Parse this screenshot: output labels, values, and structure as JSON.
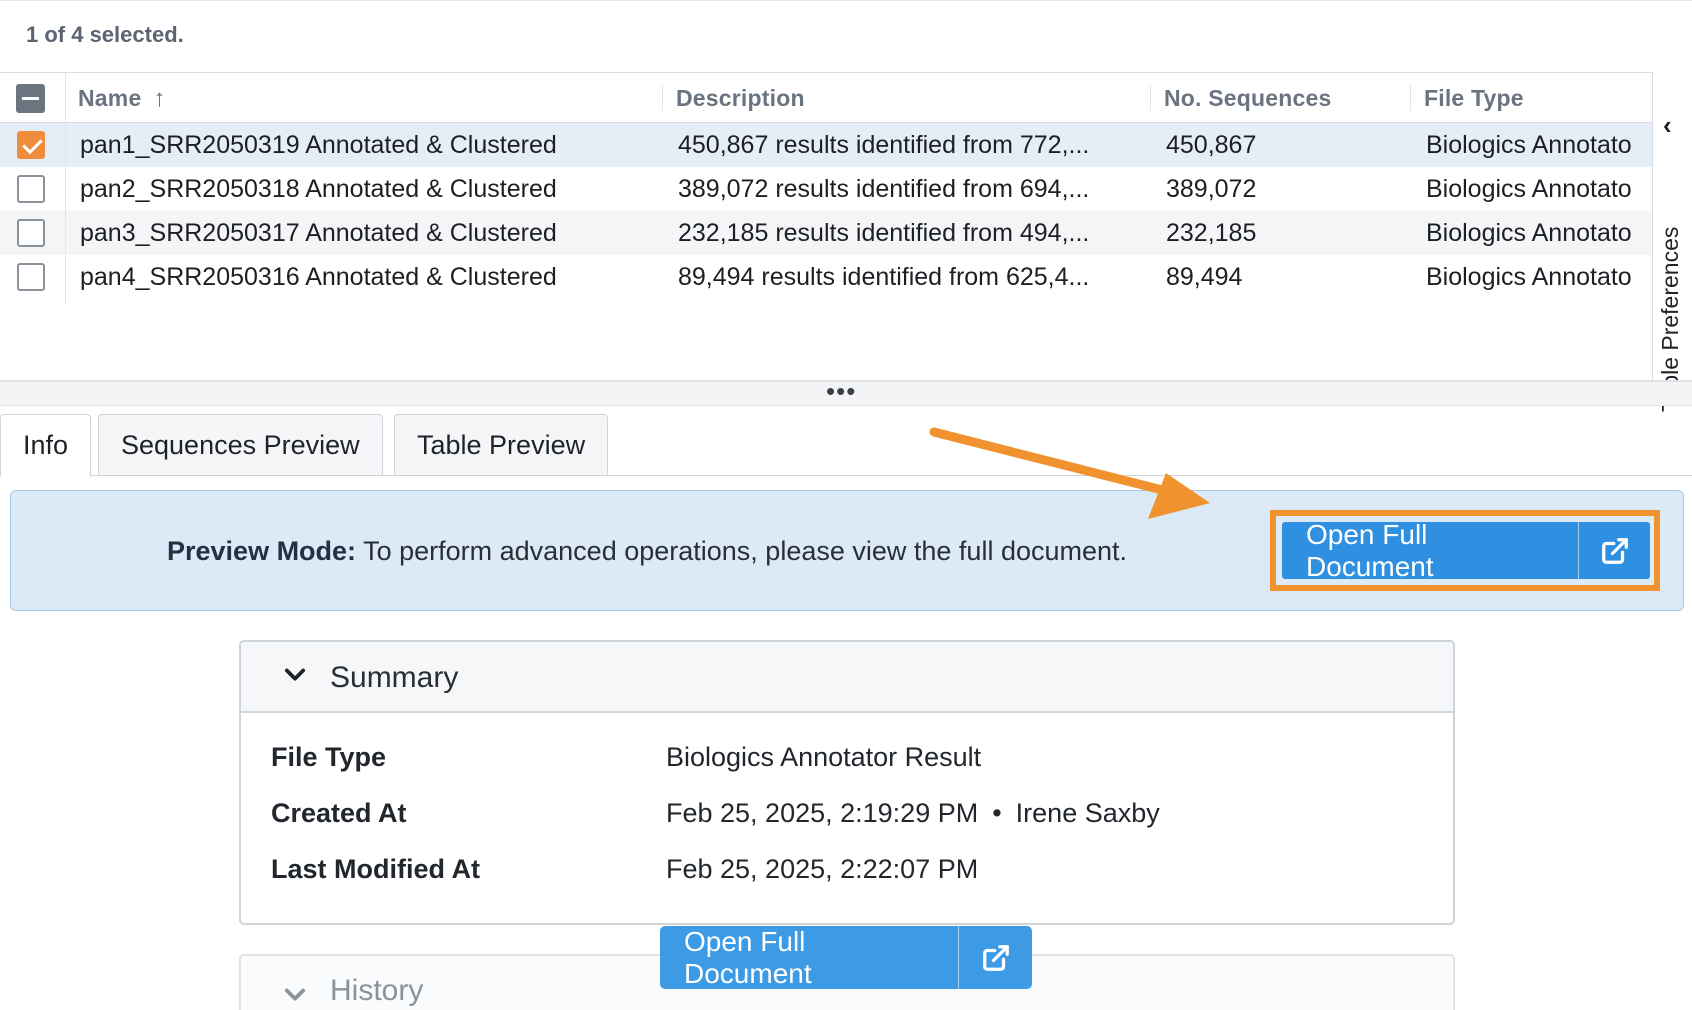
{
  "selection": {
    "status": "1 of 4 selected."
  },
  "table": {
    "columns": {
      "name": "Name",
      "description": "Description",
      "sequences": "No. Sequences",
      "file_type": "File Type"
    },
    "rows": [
      {
        "checked": true,
        "name": "pan1_SRR2050319 Annotated & Clustered",
        "description": "450,867 results identified from 772,...",
        "sequences": "450,867",
        "file_type": "Biologics Annotato"
      },
      {
        "checked": false,
        "name": "pan2_SRR2050318 Annotated & Clustered",
        "description": "389,072 results identified from 694,...",
        "sequences": "389,072",
        "file_type": "Biologics Annotato"
      },
      {
        "checked": false,
        "name": "pan3_SRR2050317 Annotated & Clustered",
        "description": "232,185 results identified from 494,...",
        "sequences": "232,185",
        "file_type": "Biologics Annotato"
      },
      {
        "checked": false,
        "name": "pan4_SRR2050316 Annotated & Clustered",
        "description": "89,494 results identified from 625,4...",
        "sequences": "89,494",
        "file_type": "Biologics Annotato"
      }
    ],
    "preferences_label": "Table Preferences"
  },
  "splitter": {
    "handle": "•••"
  },
  "tabs": [
    {
      "label": "Info",
      "active": true
    },
    {
      "label": "Sequences Preview",
      "active": false
    },
    {
      "label": "Table Preview",
      "active": false
    }
  ],
  "banner": {
    "bold": "Preview Mode:",
    "text": " To perform advanced operations, please view the full document.",
    "button_label": "Open Full Document"
  },
  "summary": {
    "title": "Summary",
    "file_type_key": "File Type",
    "file_type_val": "Biologics Annotator Result",
    "created_key": "Created At",
    "created_val": "Feb 25, 2025, 2:19:29 PM",
    "created_sep": "•",
    "created_by": "Irene Saxby",
    "modified_key": "Last Modified At",
    "modified_val": "Feb 25, 2025, 2:22:07 PM"
  },
  "history": {
    "title": "History"
  },
  "floating_button": {
    "label": "Open Full Document"
  },
  "colors": {
    "accent": "#2f8fe0",
    "highlight": "#f0922d",
    "checkbox": "#ef8d3c",
    "banner_bg": "#dbeaf6"
  },
  "icons": [
    "sort-up-icon",
    "chevron-left-icon",
    "external-link-icon",
    "chevron-down-icon"
  ]
}
